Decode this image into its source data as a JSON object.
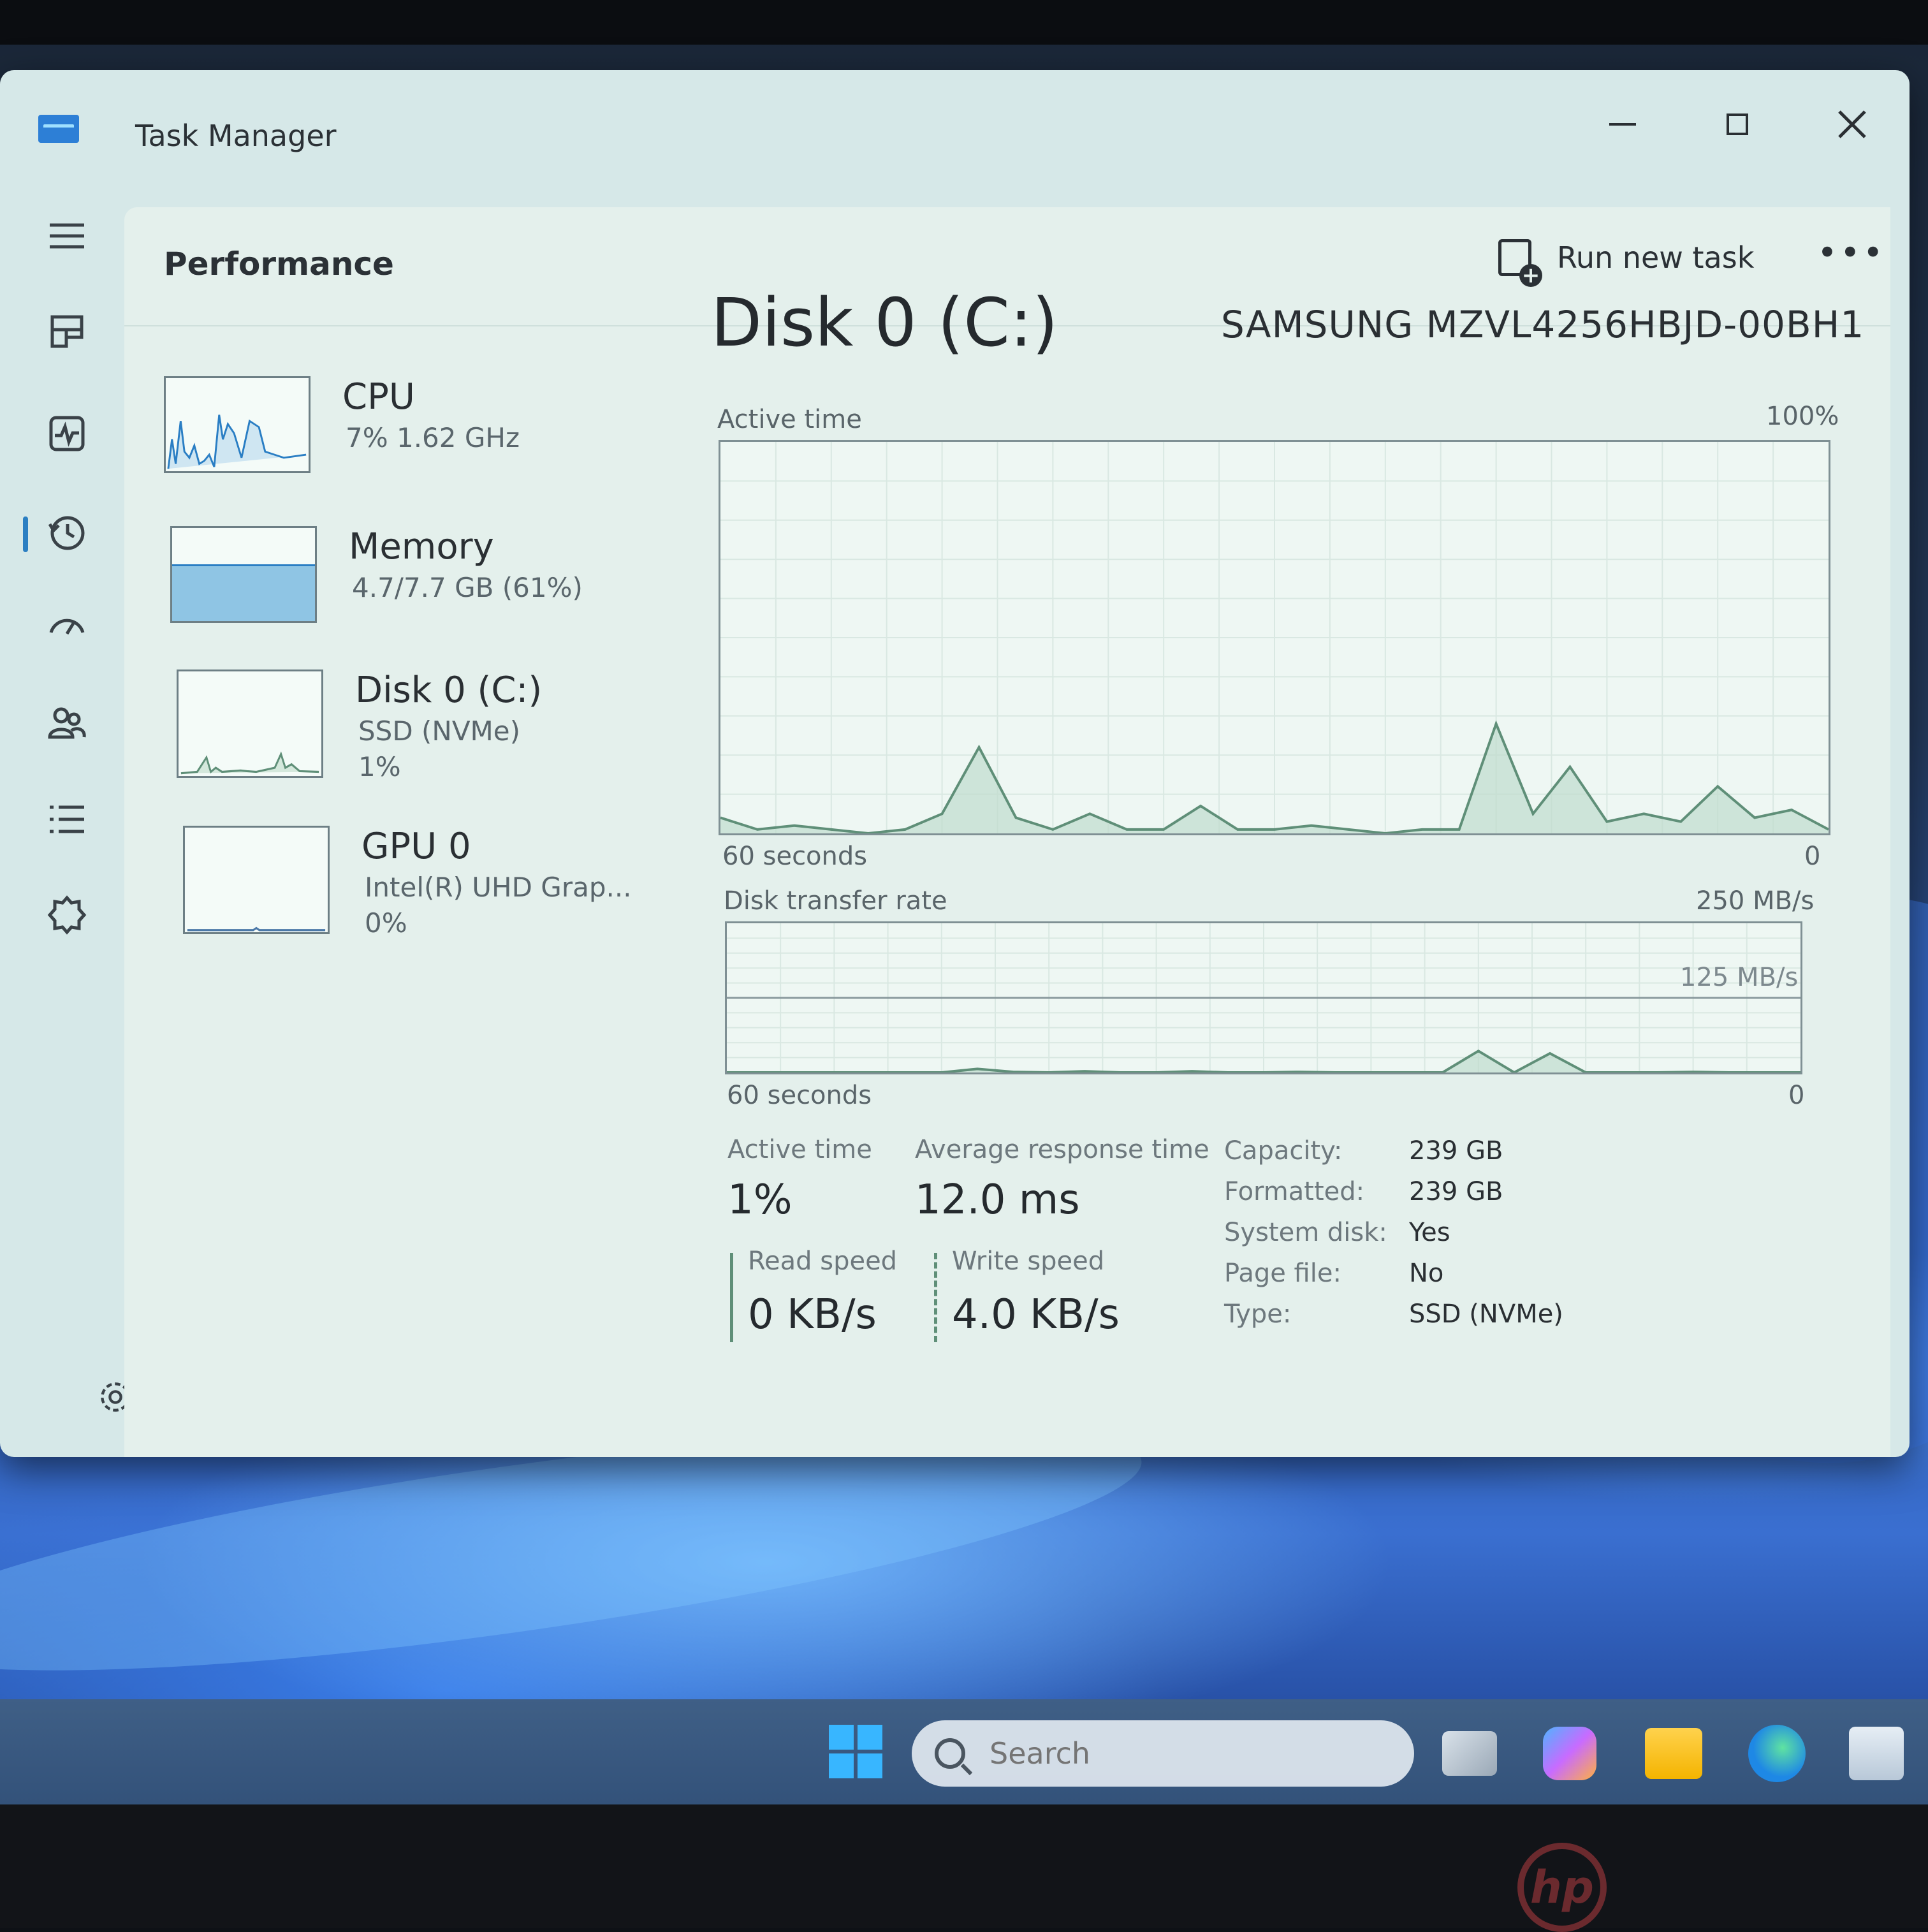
{
  "window": {
    "title": "Task Manager",
    "page_title": "Performance",
    "run_new_task": "Run new task",
    "more": "•••"
  },
  "nav": [
    "hamburger-icon",
    "processes-icon",
    "performance-icon",
    "app-history-icon",
    "startup-apps-icon",
    "users-icon",
    "details-icon",
    "services-icon",
    "settings-icon"
  ],
  "resources": [
    {
      "name": "CPU",
      "line1": "7%  1.62 GHz"
    },
    {
      "name": "Memory",
      "line1": "4.7/7.7 GB (61%)",
      "fill_fraction": 0.61
    },
    {
      "name": "Disk 0 (C:)",
      "line1": "SSD (NVMe)",
      "line2": "1%"
    },
    {
      "name": "GPU 0",
      "line1": "Intel(R) UHD Grap...",
      "line2": "0%"
    }
  ],
  "detail": {
    "title": "Disk 0 (C:)",
    "model": "SAMSUNG MZVL4256HBJD-00BH1",
    "active_graph": {
      "label": "Active time",
      "max_label": "100%",
      "x_label": "60 seconds",
      "min_label": "0"
    },
    "transfer_graph": {
      "label": "Disk transfer rate",
      "max_label": "250 MB/s",
      "mid_label": "125 MB/s",
      "x_label": "60 seconds",
      "min_label": "0"
    },
    "stats": {
      "active_time_label": "Active time",
      "active_time": "1%",
      "avg_response_label": "Average response time",
      "avg_response": "12.0 ms",
      "read_label": "Read speed",
      "read": "0 KB/s",
      "write_label": "Write speed",
      "write": "4.0 KB/s"
    },
    "properties": [
      {
        "label": "Capacity:",
        "value": "239 GB"
      },
      {
        "label": "Formatted:",
        "value": "239 GB"
      },
      {
        "label": "System disk:",
        "value": "Yes"
      },
      {
        "label": "Page file:",
        "value": "No"
      },
      {
        "label": "Type:",
        "value": "SSD (NVMe)"
      }
    ]
  },
  "chart_data": [
    {
      "type": "area",
      "title": "Active time",
      "xlabel": "60 seconds",
      "ylim": [
        0,
        100
      ],
      "x": [
        60,
        58,
        56,
        54,
        52,
        50,
        48,
        46,
        44,
        42,
        40,
        38,
        36,
        34,
        32,
        30,
        28,
        26,
        24,
        22,
        20,
        18,
        16,
        14,
        12,
        10,
        8,
        6,
        4,
        2,
        0
      ],
      "values": [
        4,
        1,
        2,
        1,
        0,
        1,
        5,
        22,
        4,
        1,
        5,
        1,
        1,
        7,
        1,
        1,
        2,
        1,
        0,
        1,
        1,
        28,
        5,
        17,
        3,
        5,
        3,
        12,
        4,
        6,
        1
      ]
    },
    {
      "type": "area",
      "title": "Disk transfer rate",
      "xlabel": "60 seconds",
      "ylim": [
        0,
        250
      ],
      "x": [
        60,
        58,
        56,
        54,
        52,
        50,
        48,
        46,
        44,
        42,
        40,
        38,
        36,
        34,
        32,
        30,
        28,
        26,
        24,
        22,
        20,
        18,
        16,
        14,
        12,
        10,
        8,
        6,
        4,
        2,
        0
      ],
      "values": [
        0,
        0,
        0,
        0,
        0,
        0,
        0,
        6,
        1,
        0,
        2,
        0,
        0,
        2,
        0,
        0,
        1,
        0,
        0,
        0,
        0,
        36,
        0,
        32,
        0,
        0,
        0,
        1,
        0,
        0,
        0
      ]
    }
  ],
  "taskbar": {
    "search_placeholder": "Search"
  },
  "brand": {
    "monitor_logo": "hp"
  },
  "colors": {
    "graph_line": "#5f8f78",
    "graph_fill": "#bfdccd",
    "cpu_line": "#2a7ec4",
    "memory_fill": "#8fc5e4",
    "accent": "#2c7fc2"
  }
}
